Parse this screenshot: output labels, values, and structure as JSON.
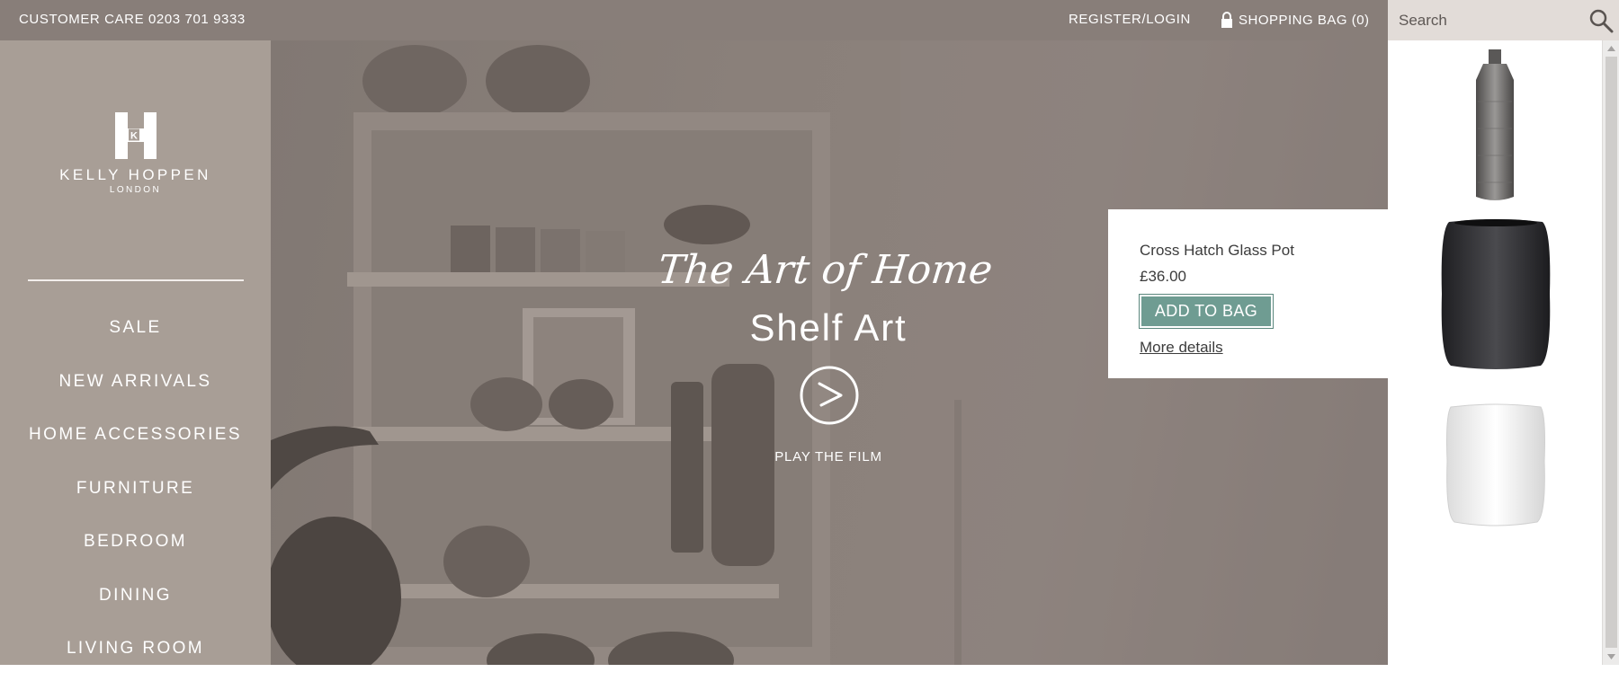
{
  "topbar": {
    "customer_care": "CUSTOMER CARE 0203 701 9333",
    "register_login": "REGISTER/LOGIN",
    "shopping_bag": "SHOPPING BAG (0)",
    "bag_icon": "lock-bag-icon"
  },
  "search": {
    "placeholder": "Search",
    "value": "",
    "icon": "search-icon"
  },
  "brand": {
    "monogram": "K",
    "name": "KELLY HOPPEN",
    "location": "LONDON"
  },
  "nav": {
    "items": [
      {
        "label": "SALE"
      },
      {
        "label": "NEW ARRIVALS"
      },
      {
        "label": "HOME ACCESSORIES"
      },
      {
        "label": "FURNITURE"
      },
      {
        "label": "BEDROOM"
      },
      {
        "label": "DINING"
      },
      {
        "label": "LIVING ROOM"
      }
    ]
  },
  "hero": {
    "script_title": "The Art of Home",
    "title": "Shelf Art",
    "play_label": "PLAY THE FILM",
    "play_icon": "play-circle-icon"
  },
  "product_popover": {
    "name": "Cross Hatch Glass Pot",
    "price": "£36.00",
    "add_to_bag": "ADD TO BAG",
    "more_details": "More details"
  },
  "product_thumbnails": [
    {
      "icon": "grey-bottle-vase-image"
    },
    {
      "icon": "dark-square-vase-image"
    },
    {
      "icon": "white-pot-image"
    }
  ],
  "colors": {
    "topbar": "#887e79",
    "sidebar": "#a89e96",
    "search_bg": "#e2dcd8",
    "add_button": "#6f9c92"
  }
}
